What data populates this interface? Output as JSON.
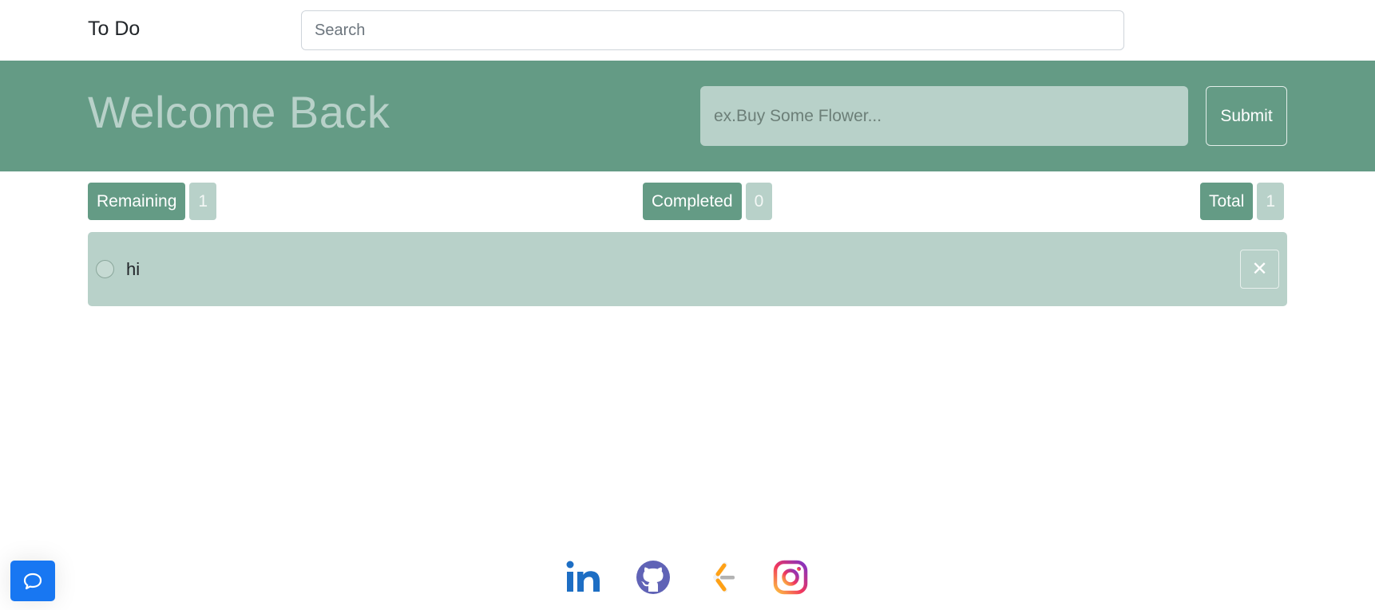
{
  "navbar": {
    "brand": "To Do",
    "search_placeholder": "Search"
  },
  "hero": {
    "title": "Welcome Back",
    "task_placeholder": "ex.Buy Some Flower...",
    "submit_label": "Submit"
  },
  "stats": {
    "remaining_label": "Remaining",
    "remaining_count": "1",
    "completed_label": "Completed",
    "completed_count": "0",
    "total_label": "Total",
    "total_count": "1"
  },
  "todos": [
    {
      "text": "hi",
      "completed": false,
      "delete_icon": "close-icon"
    }
  ],
  "footer": {
    "social_icons": [
      "linkedin-icon",
      "github-icon",
      "sourcegraph-icon",
      "instagram-icon"
    ]
  },
  "chat": {
    "icon": "chat-bubble-icon"
  },
  "colors": {
    "primary": "#649b85",
    "primary_light": "#b8d1c9",
    "chat_button": "#1877f2"
  }
}
